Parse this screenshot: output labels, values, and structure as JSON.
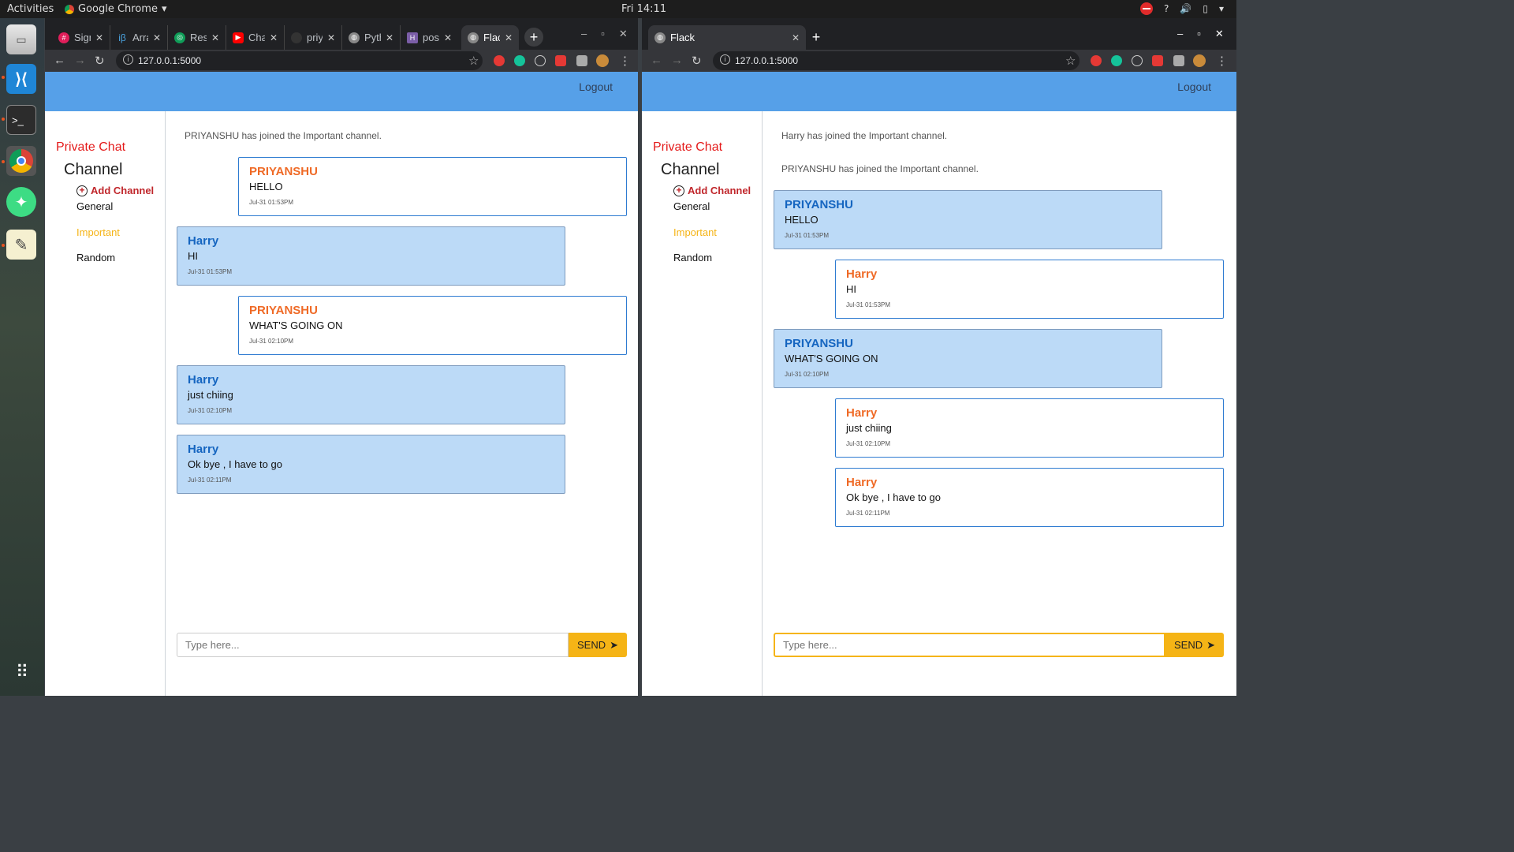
{
  "gnome": {
    "activities": "Activities",
    "app_name": "Google Chrome",
    "clock": "Fri 14:11",
    "tray": [
      "?",
      "🔊",
      "▯",
      "▾"
    ]
  },
  "dock": {
    "apps": [
      {
        "name": "files",
        "icon": "files-icon"
      },
      {
        "name": "vscode",
        "icon": "vscode-icon"
      },
      {
        "name": "terminal",
        "icon": "terminal-icon"
      },
      {
        "name": "chrome",
        "icon": "chrome-icon"
      },
      {
        "name": "android-studio",
        "icon": "android-studio-icon"
      },
      {
        "name": "text-editor",
        "icon": "text-editor-icon"
      }
    ],
    "show_apps_icon": "grid-icon"
  },
  "left_window": {
    "tabs": [
      {
        "label": "Sign",
        "icon_color": "#e01e5a"
      },
      {
        "label": "Arra",
        "icon_color": "#4aa3df"
      },
      {
        "label": "Resi",
        "icon_color": "#0f9d58"
      },
      {
        "label": "Cha",
        "icon_color": "#ff0000"
      },
      {
        "label": "priy",
        "icon_color": "#333333"
      },
      {
        "label": "Pyth",
        "icon_color": "#888888"
      },
      {
        "label": "post",
        "icon_color": "#7b5ea7"
      },
      {
        "label": "Flac",
        "icon_color": "#888888"
      }
    ],
    "url": "127.0.0.1:5000",
    "notices": [
      "PRIYANSHU has joined the Important channel."
    ],
    "messages": [
      {
        "name": "PRIYANSHU",
        "text": "HELLO",
        "time": "Jul-31 01:53PM"
      },
      {
        "name": "Harry",
        "text": "HI",
        "time": "Jul-31 01:53PM"
      },
      {
        "name": "PRIYANSHU",
        "text": "WHAT'S GOING ON",
        "time": "Jul-31 02:10PM"
      },
      {
        "name": "Harry",
        "text": "just chiing",
        "time": "Jul-31 02:10PM"
      },
      {
        "name": "Harry",
        "text": "Ok bye , I have to go",
        "time": "Jul-31 02:11PM"
      }
    ]
  },
  "right_window": {
    "tabs": [
      {
        "label": "Flack"
      }
    ],
    "url": "127.0.0.1:5000",
    "notices": [
      "Harry has joined the Important channel.",
      "PRIYANSHU has joined the Important channel."
    ],
    "messages": [
      {
        "name": "PRIYANSHU",
        "text": "HELLO",
        "time": "Jul-31 01:53PM"
      },
      {
        "name": "Harry",
        "text": "HI",
        "time": "Jul-31 01:53PM"
      },
      {
        "name": "PRIYANSHU",
        "text": "WHAT'S GOING ON",
        "time": "Jul-31 02:10PM"
      },
      {
        "name": "Harry",
        "text": "just chiing",
        "time": "Jul-31 02:10PM"
      },
      {
        "name": "Harry",
        "text": "Ok bye , I have to go",
        "time": "Jul-31 02:11PM"
      }
    ]
  },
  "app": {
    "logout": "Logout",
    "brand": "Private Chat",
    "channel_heading": "Channel",
    "add_channel": "Add Channel",
    "channels": [
      "General",
      "Important",
      "Random"
    ],
    "active_channel": "Important",
    "input_placeholder": "Type here...",
    "send_label": "SEND"
  },
  "colors": {
    "navbar": "#56a0e8",
    "accent": "#f5b416",
    "brand": "#e41b1b",
    "own_name": "#ef6a26",
    "other_name": "#1565c0",
    "other_bubble": "#bcdaf7"
  }
}
